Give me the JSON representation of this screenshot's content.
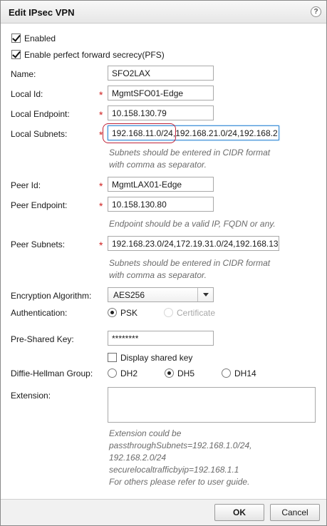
{
  "dialog": {
    "title": "Edit IPsec VPN",
    "help_icon": "?"
  },
  "enabled": {
    "label": "Enabled",
    "checked": true
  },
  "pfs": {
    "label": "Enable perfect forward secrecy(PFS)",
    "checked": true
  },
  "required_marker": "*",
  "name": {
    "label": "Name:",
    "value": "SFO2LAX"
  },
  "local_id": {
    "label": "Local Id:",
    "value": "MgmtSFO01-Edge"
  },
  "local_endpoint": {
    "label": "Local Endpoint:",
    "value": "10.158.130.79"
  },
  "local_subnets": {
    "label": "Local Subnets:",
    "value": "192.168.11.0/24,192.168.21.0/24,192.168.2",
    "hint_line1": "Subnets should be entered in CIDR format",
    "hint_line2": "with comma as separator."
  },
  "peer_id": {
    "label": "Peer Id:",
    "value": "MgmtLAX01-Edge"
  },
  "peer_endpoint": {
    "label": "Peer Endpoint:",
    "value": "10.158.130.80",
    "hint": "Endpoint should be a valid IP, FQDN or any."
  },
  "peer_subnets": {
    "label": "Peer Subnets:",
    "value": "192.168.23.0/24,172.19.31.0/24,192.168.13",
    "hint_line1": "Subnets should be entered in CIDR format",
    "hint_line2": "with comma as separator."
  },
  "encryption": {
    "label": "Encryption Algorithm:",
    "value": "AES256"
  },
  "authentication": {
    "label": "Authentication:",
    "options": [
      {
        "label": "PSK",
        "selected": true,
        "enabled": true
      },
      {
        "label": "Certificate",
        "selected": false,
        "enabled": false
      }
    ]
  },
  "psk": {
    "label": "Pre-Shared Key:",
    "value": "********"
  },
  "display_shared_key": {
    "label": "Display shared key",
    "checked": false
  },
  "dh_group": {
    "label": "Diffie-Hellman Group:",
    "options": [
      {
        "label": "DH2",
        "selected": false
      },
      {
        "label": "DH5",
        "selected": true
      },
      {
        "label": "DH14",
        "selected": false
      }
    ]
  },
  "extension": {
    "label": "Extension:",
    "value": "",
    "hint_lines": [
      "Extension could be",
      "passthroughSubnets=192.168.1.0/24,",
      "192.168.2.0/24",
      "securelocaltrafficbyip=192.168.1.1",
      "For others please refer to user guide."
    ]
  },
  "buttons": {
    "ok": "OK",
    "cancel": "Cancel"
  },
  "colors": {
    "required": "#d02020",
    "hint": "#6b6b6b",
    "focus_border": "#3a8cd6",
    "annotation": "#c0243a"
  }
}
